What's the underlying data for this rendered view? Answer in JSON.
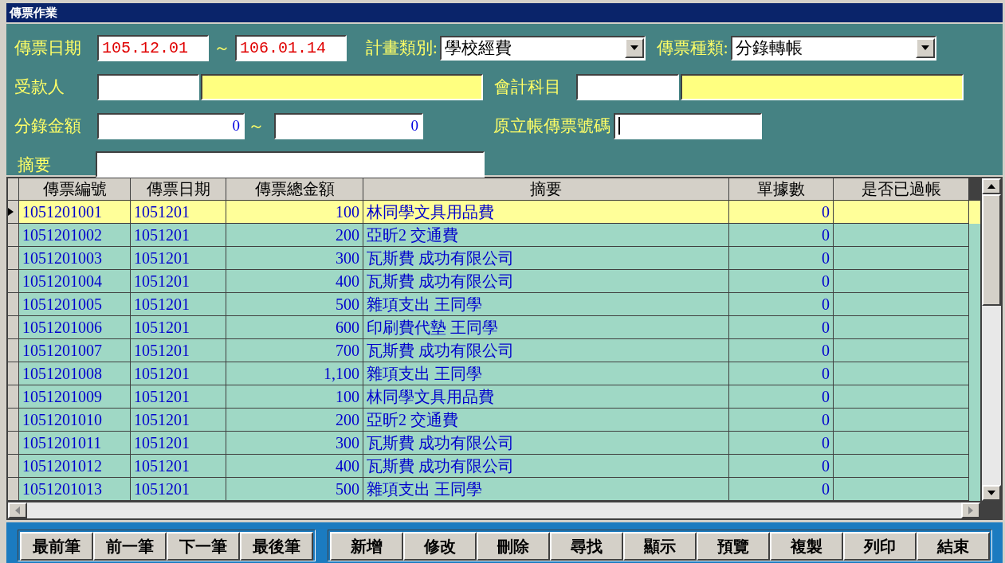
{
  "window": {
    "title": "傳票作業"
  },
  "filters": {
    "date": {
      "label": "傳票日期",
      "from": "105.12.01",
      "separator": "～",
      "to": "106.01.14"
    },
    "plan_type": {
      "label": "計畫類別:",
      "value": "學校經費"
    },
    "voucher_type": {
      "label": "傳票種類:",
      "value": "分錄轉帳"
    },
    "payee": {
      "label": "受款人"
    },
    "account": {
      "label": "會計科目"
    },
    "amount": {
      "label": "分錄金額",
      "from": "0",
      "separator": "～",
      "to": "0"
    },
    "original_voucher_no": {
      "label": "原立帳傳票號碼",
      "focused": true
    },
    "summary": {
      "label": "摘要"
    }
  },
  "table": {
    "columns": [
      "傳票編號",
      "傳票日期",
      "傳票總金額",
      "摘要",
      "單據數",
      "是否已過帳"
    ],
    "rows": [
      {
        "voucher_no": "1051201001",
        "date": "1051201",
        "total": "100",
        "summary": "林同學文具用品費",
        "documents": "0",
        "selected": true
      },
      {
        "voucher_no": "1051201002",
        "date": "1051201",
        "total": "200",
        "summary": "亞昕2  交通費",
        "documents": "0",
        "selected": false
      },
      {
        "voucher_no": "1051201003",
        "date": "1051201",
        "total": "300",
        "summary": "瓦斯費  成功有限公司",
        "documents": "0",
        "selected": false
      },
      {
        "voucher_no": "1051201004",
        "date": "1051201",
        "total": "400",
        "summary": "瓦斯費  成功有限公司",
        "documents": "0",
        "selected": false
      },
      {
        "voucher_no": "1051201005",
        "date": "1051201",
        "total": "500",
        "summary": "雜項支出  王同學",
        "documents": "0",
        "selected": false
      },
      {
        "voucher_no": "1051201006",
        "date": "1051201",
        "total": "600",
        "summary": "印刷費代墊  王同學",
        "documents": "0",
        "selected": false
      },
      {
        "voucher_no": "1051201007",
        "date": "1051201",
        "total": "700",
        "summary": "瓦斯費  成功有限公司",
        "documents": "0",
        "selected": false
      },
      {
        "voucher_no": "1051201008",
        "date": "1051201",
        "total": "1,100",
        "summary": "雜項支出  王同學",
        "documents": "0",
        "selected": false
      },
      {
        "voucher_no": "1051201009",
        "date": "1051201",
        "total": "100",
        "summary": "林同學文具用品費",
        "documents": "0",
        "selected": false
      },
      {
        "voucher_no": "1051201010",
        "date": "1051201",
        "total": "200",
        "summary": "亞昕2  交通費",
        "documents": "0",
        "selected": false
      },
      {
        "voucher_no": "1051201011",
        "date": "1051201",
        "total": "300",
        "summary": "瓦斯費  成功有限公司",
        "documents": "0",
        "selected": false
      },
      {
        "voucher_no": "1051201012",
        "date": "1051201",
        "total": "400",
        "summary": "瓦斯費  成功有限公司",
        "documents": "0",
        "selected": false
      },
      {
        "voucher_no": "1051201013",
        "date": "1051201",
        "total": "500",
        "summary": "雜項支出  王同學",
        "documents": "0",
        "selected": false
      }
    ]
  },
  "navigation_buttons": [
    "最前筆",
    "前一筆",
    "下一筆",
    "最後筆"
  ],
  "action_buttons": [
    "新增",
    "修改",
    "刪除",
    "尋找",
    "顯示",
    "預覽",
    "複製",
    "列印",
    "結束"
  ]
}
